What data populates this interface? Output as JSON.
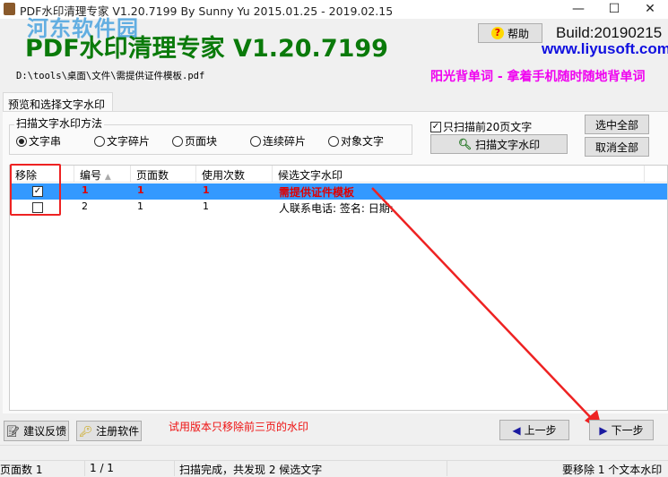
{
  "window": {
    "title": "PDF水印清理专家 V1.20.7199 By Sunny Yu 2015.01.25 - 2019.02.15",
    "minimize": "—",
    "maximize": "☐",
    "close": "✕"
  },
  "header": {
    "watermark_logo": "河东软件园",
    "app_title": "PDF水印清理专家 V1.20.7199",
    "help_label": "帮助",
    "build": "Build:20190215",
    "url": "www.liyusoft.com",
    "file_path": "D:\\tools\\桌面\\文件\\需提供证件模板.pdf",
    "promo": "阳光背单词 - 拿着手机随时随地背单词"
  },
  "tabs": [
    {
      "label": "预览和选择文字水印"
    }
  ],
  "scan": {
    "group_label": "扫描文字水印方法",
    "methods": [
      "文字串",
      "文字碎片",
      "页面块",
      "连续碎片",
      "对象文字"
    ],
    "selected": 0,
    "only_first_pages_label": "只扫描前20页文字",
    "only_first_pages_checked": true,
    "scan_button": "扫描文字水印",
    "select_all": "选中全部",
    "deselect_all": "取消全部"
  },
  "table": {
    "columns": [
      "移除",
      "编号",
      "页面数",
      "使用次数",
      "候选文字水印"
    ],
    "rows": [
      {
        "remove": true,
        "id": "1",
        "pages": "1",
        "uses": "1",
        "text": "需提供证件模板",
        "selected": true
      },
      {
        "remove": false,
        "id": "2",
        "pages": "1",
        "uses": "1",
        "text": "人联系电话: 签名: 日期:",
        "selected": false
      }
    ]
  },
  "footer": {
    "feedback": "建议反馈",
    "register": "注册软件",
    "trial_notice": "试用版本只移除前三页的水印",
    "prev": "上一步",
    "next": "下一步"
  },
  "status": {
    "pages": "页面数 1",
    "page_pos": "1 / 1",
    "scan_result": "扫描完成，共发现 2 候选文字",
    "remove_count": "要移除 1 个文本水印"
  },
  "colors": {
    "title_green": "#0a7a0a",
    "url_blue": "#1010e0",
    "promo_magenta": "#f000f0",
    "selection": "#3399ff",
    "annotation_red": "#ee2222"
  }
}
